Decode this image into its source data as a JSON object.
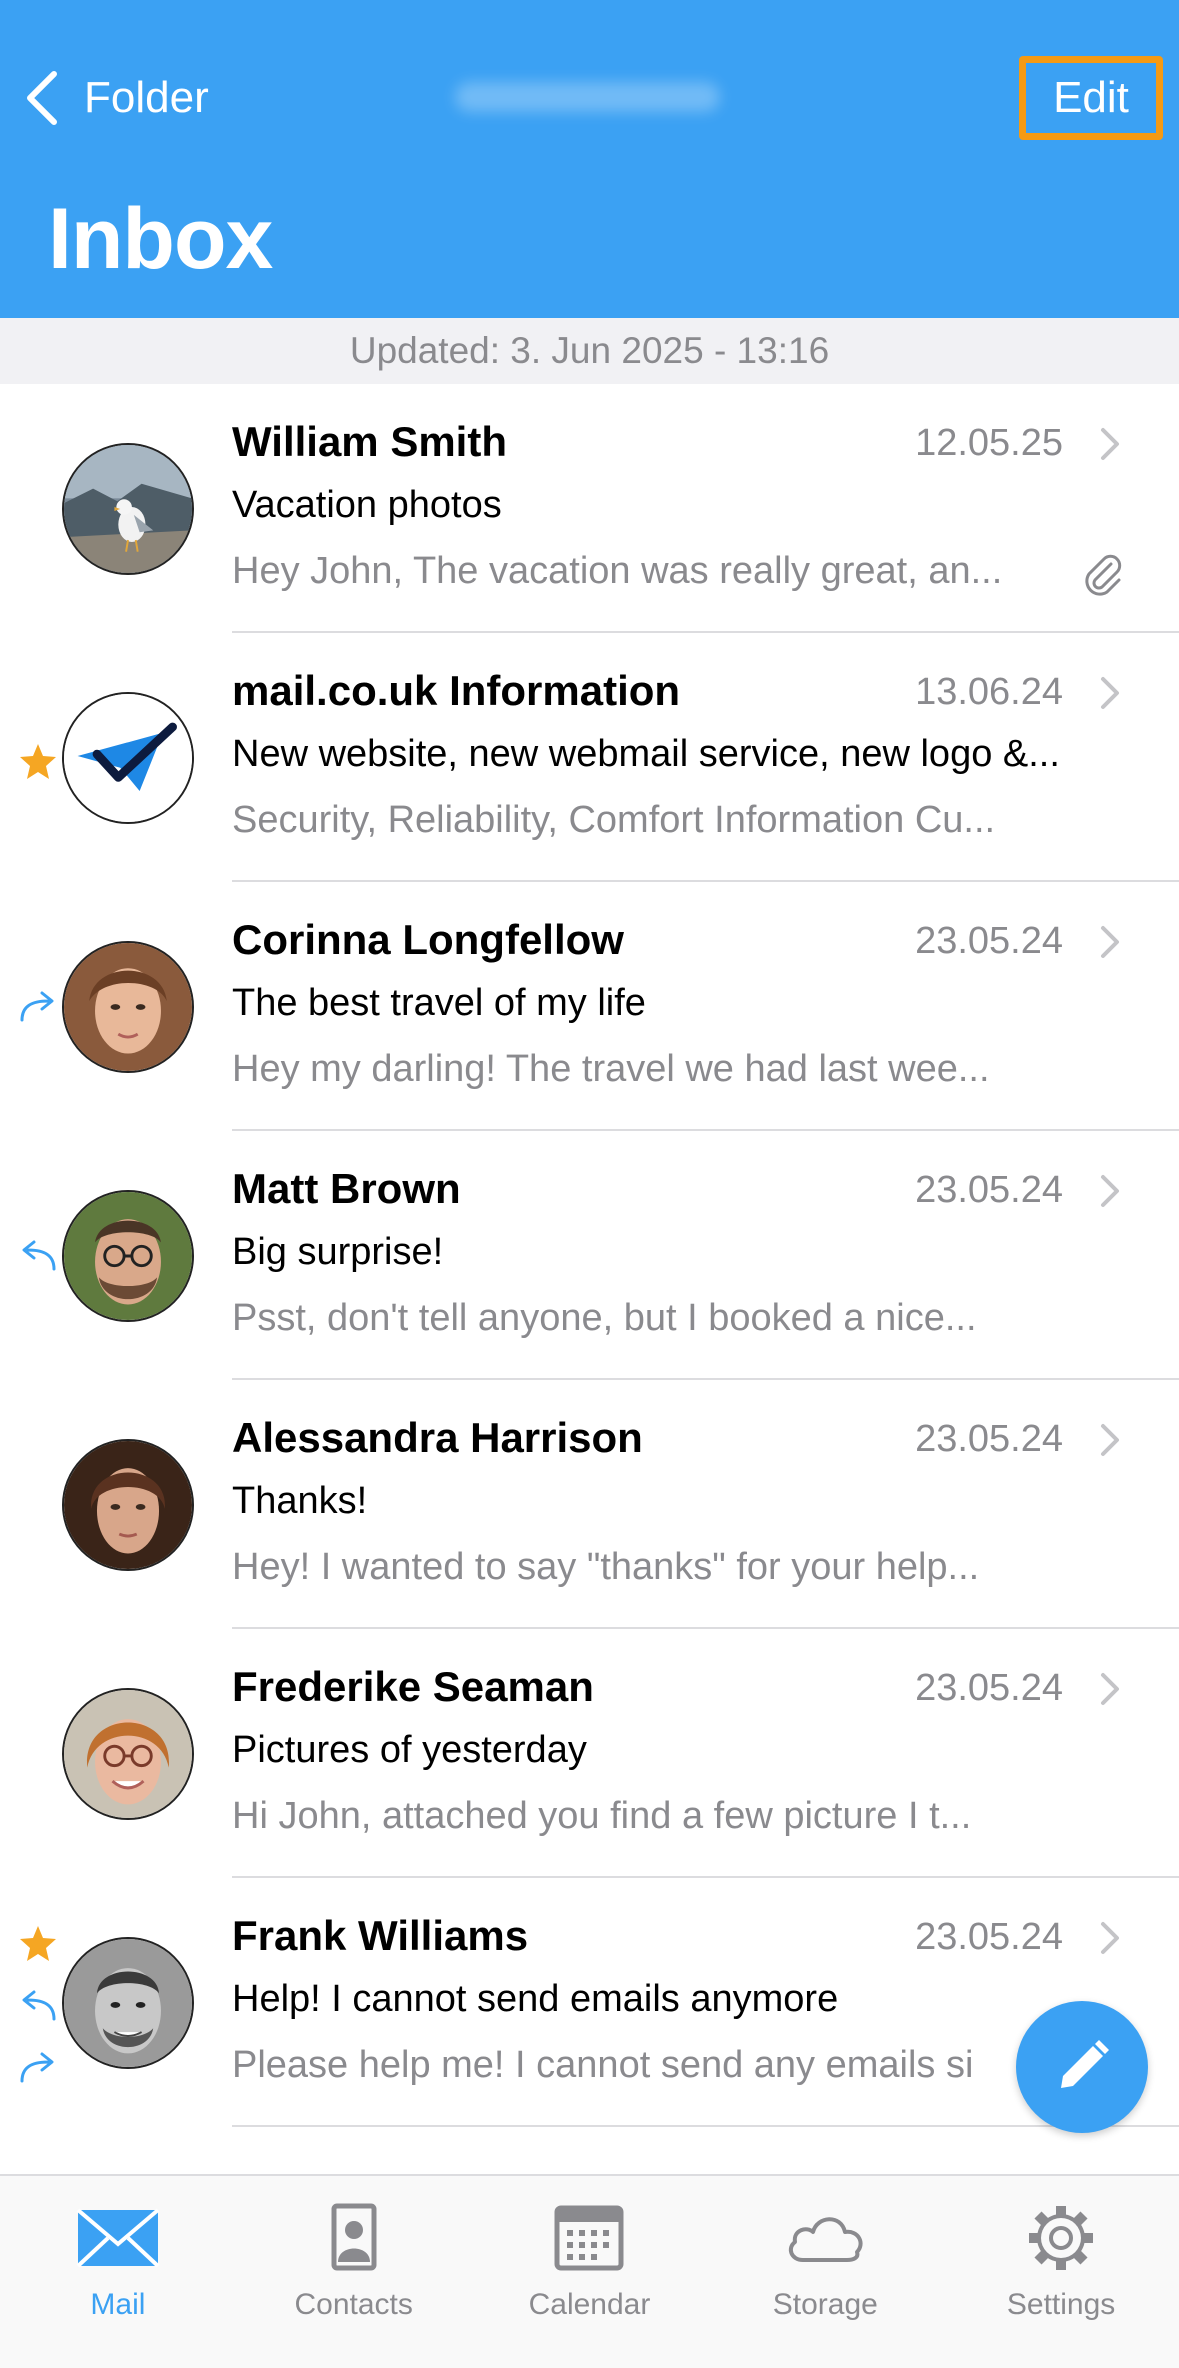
{
  "header": {
    "back_label": "Folder",
    "edit_label": "Edit",
    "title": "Inbox"
  },
  "updated_text": "Updated: 3. Jun 2025 - 13:16",
  "emails": [
    {
      "sender": "William Smith",
      "date": "12.05.25",
      "subject": "Vacation photos",
      "preview": "Hey John, The vacation was really great, an...",
      "has_attachment": true
    },
    {
      "sender": "mail.co.uk Information",
      "date": "13.06.24",
      "subject": "New website, new webmail service, new logo &...",
      "preview": "Security, Reliability, Comfort Information Cu...",
      "starred": true
    },
    {
      "sender": "Corinna Longfellow",
      "date": "23.05.24",
      "subject": "The best travel of my life",
      "preview": "Hey my darling! The travel we had last wee...",
      "forwarded": true
    },
    {
      "sender": "Matt Brown",
      "date": "23.05.24",
      "subject": "Big surprise!",
      "preview": "Psst, don't tell anyone, but I booked a nice...",
      "replied": true
    },
    {
      "sender": "Alessandra Harrison",
      "date": "23.05.24",
      "subject": "Thanks!",
      "preview": "Hey! I wanted to say \"thanks\" for your help..."
    },
    {
      "sender": "Frederike Seaman",
      "date": "23.05.24",
      "subject": "Pictures of yesterday",
      "preview": "Hi John, attached you find a few picture I t..."
    },
    {
      "sender": "Frank Williams",
      "date": "23.05.24",
      "subject": "Help! I cannot send emails anymore",
      "preview": "Please help me! I cannot send any emails si",
      "starred": true,
      "replied": true,
      "forwarded": true
    }
  ],
  "tabs": [
    {
      "label": "Mail",
      "icon": "mail-icon",
      "active": true
    },
    {
      "label": "Contacts",
      "icon": "contacts-icon"
    },
    {
      "label": "Calendar",
      "icon": "calendar-icon"
    },
    {
      "label": "Storage",
      "icon": "cloud-icon"
    },
    {
      "label": "Settings",
      "icon": "gear-icon"
    }
  ],
  "colors": {
    "accent": "#3BA1F3",
    "highlight_border": "#F59A13",
    "star": "#F5A623",
    "secondary_text": "#8A8A8E"
  }
}
